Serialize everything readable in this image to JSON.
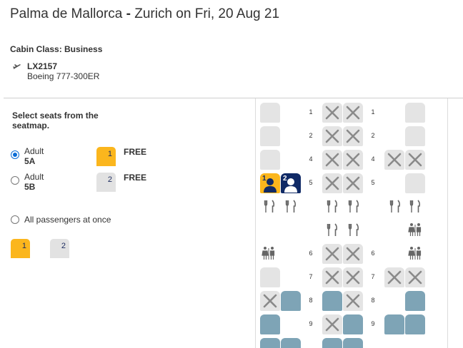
{
  "header": {
    "title_from": "Palma de Mallorca",
    "title_sep": " - ",
    "title_to": "Zurich on Fri, 20 Aug 21"
  },
  "flight": {
    "cabin_class": "Cabin Class: Business",
    "number": "LX2157",
    "aircraft": "Boeing 777-300ER",
    "icon": "airplane-icon"
  },
  "panel": {
    "title": "Select seats from the seatmap.",
    "passengers": [
      {
        "type": "Adult",
        "seat": "5A",
        "badge": "1",
        "price": "FREE",
        "selected": true
      },
      {
        "type": "Adult",
        "seat": "5B",
        "badge": "2",
        "price": "FREE",
        "selected": false
      }
    ],
    "all_label": "All passengers at once",
    "all_badges": [
      "1",
      "2"
    ]
  },
  "colors": {
    "passenger_1": "#fbb61d",
    "passenger_2_selected": "#102a66",
    "free_seat": "#e4e4e4",
    "preferred_seat": "#7ea4b6",
    "radio_accent": "#0a6cd6"
  },
  "seatmap": {
    "rows": [
      "1",
      "2",
      "4",
      "5",
      "6",
      "7",
      "8",
      "9"
    ],
    "facilities": [
      "galley-icon",
      "lavatory-icon"
    ]
  }
}
